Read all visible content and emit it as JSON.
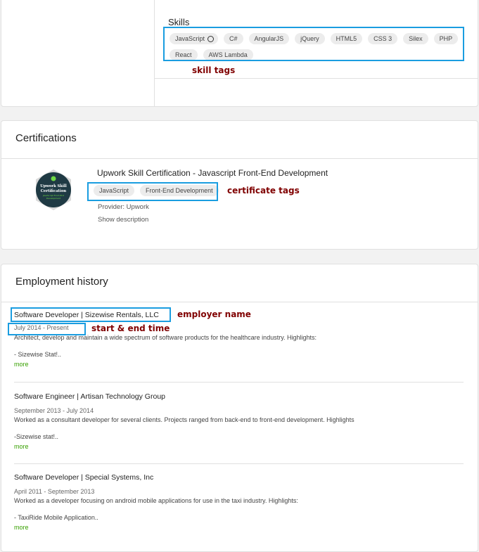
{
  "skills": {
    "title": "Skills",
    "tags": [
      "JavaScript",
      "C#",
      "AngularJS",
      "jQuery",
      "HTML5",
      "CSS 3",
      "Silex",
      "PHP",
      "React",
      "AWS Lambda"
    ],
    "annotation": "skill tags"
  },
  "certifications": {
    "title": "Certifications",
    "items": [
      {
        "name": "Upwork Skill Certification - Javascript Front-End Development",
        "tags": [
          "JavaScript",
          "Front-End Development"
        ],
        "provider": "Provider: Upwork",
        "show_description": "Show description",
        "badge_line1": "Upwork Skill",
        "badge_line2": "Certification",
        "badge_line3": "JavaScript Front-End",
        "badge_line4": "Development"
      }
    ],
    "annotation": "certificate tags"
  },
  "employment": {
    "title": "Employment history",
    "annotation_employer": "employer name",
    "annotation_time": "start & end time",
    "jobs": [
      {
        "title": "Software Developer | Sizewise Rentals, LLC",
        "dates": "July 2014 - Present",
        "description": "Architect, develop and maintain a wide spectrum of software products for the healthcare industry. Highlights:",
        "snippet": "- Sizewise Stat!..",
        "more": "more"
      },
      {
        "title": "Software Engineer | Artisan Technology Group",
        "dates": "September 2013 - July 2014",
        "description": "Worked as a consultant developer for several clients. Projects ranged from back-end to front-end development. Highlights",
        "snippet": "-Sizewise stat!..",
        "more": "more"
      },
      {
        "title": "Software Developer | Special Systems, Inc",
        "dates": "April 2011 - September 2013",
        "description": "Worked as a developer focusing on android mobile applications for use in the taxi industry. Highlights:",
        "snippet": "- TaxiRide Mobile Application..",
        "more": "more"
      }
    ]
  },
  "colors": {
    "annotation_box": "#1a9de0",
    "annotation_text": "#800000",
    "link_green": "#37a000",
    "badge_bg": "#1f3a44"
  }
}
